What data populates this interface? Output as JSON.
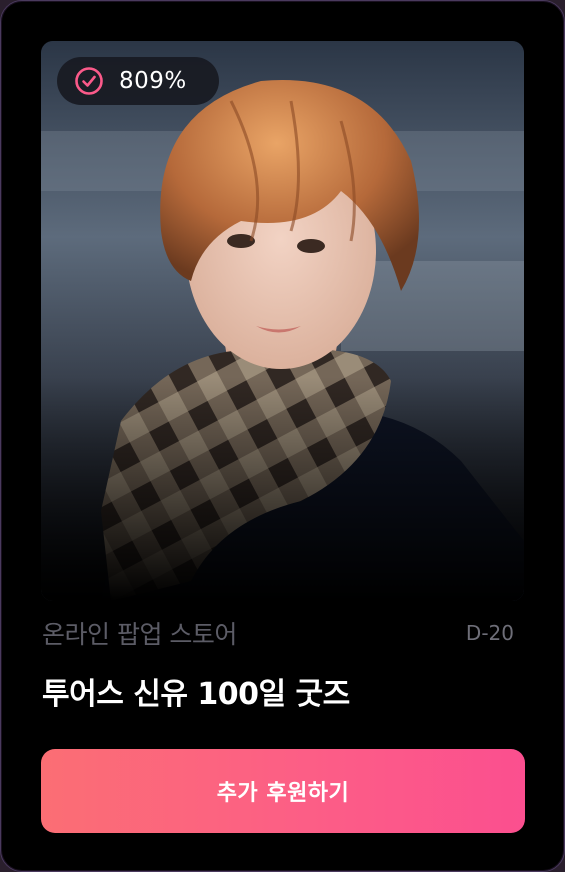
{
  "badge": {
    "icon": "check-circle-icon",
    "percent": "809%",
    "accent_color": "#fb4f8f"
  },
  "project": {
    "category": "온라인 팝업 스토어",
    "dday": "D-20",
    "title": "투어스 신유 100일 굿즈"
  },
  "cta": {
    "label": "추가 후원하기",
    "gradient_start": "#fb6e74",
    "gradient_end": "#fb4f8f"
  }
}
